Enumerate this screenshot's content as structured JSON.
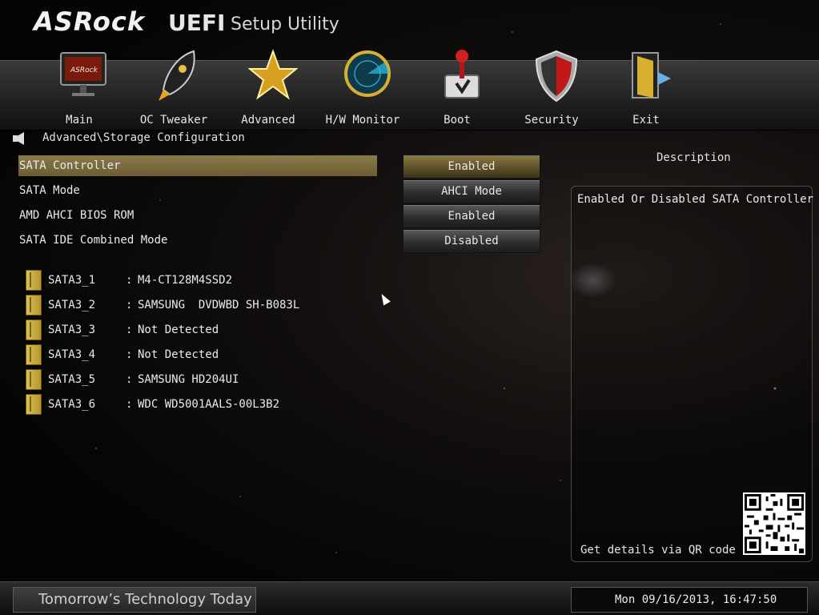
{
  "header": {
    "brand": "ASRock",
    "title_strong": "UEFI",
    "title_rest": "Setup Utility"
  },
  "nav": {
    "items": [
      {
        "label": "Main",
        "icon": "monitor-icon"
      },
      {
        "label": "OC Tweaker",
        "icon": "rocket-icon"
      },
      {
        "label": "Advanced",
        "icon": "star-icon"
      },
      {
        "label": "H/W Monitor",
        "icon": "radar-icon"
      },
      {
        "label": "Boot",
        "icon": "joystick-icon"
      },
      {
        "label": "Security",
        "icon": "shield-icon"
      },
      {
        "label": "Exit",
        "icon": "exit-door-icon"
      }
    ]
  },
  "breadcrumb": "Advanced\\Storage Configuration",
  "settings": [
    {
      "label": "SATA Controller",
      "value": "Enabled"
    },
    {
      "label": "SATA Mode",
      "value": "AHCI Mode"
    },
    {
      "label": "AMD AHCI BIOS ROM",
      "value": "Enabled"
    },
    {
      "label": "SATA IDE Combined Mode",
      "value": "Disabled"
    }
  ],
  "drives": [
    {
      "port": "SATA3_1",
      "sep": ":",
      "model": "M4-CT128M4SSD2"
    },
    {
      "port": "SATA3_2",
      "sep": ":",
      "model": "SAMSUNG  DVDWBD SH-B083L"
    },
    {
      "port": "SATA3_3",
      "sep": ":",
      "model": "Not Detected"
    },
    {
      "port": "SATA3_4",
      "sep": ":",
      "model": "Not Detected"
    },
    {
      "port": "SATA3_5",
      "sep": ":",
      "model": "SAMSUNG HD204UI"
    },
    {
      "port": "SATA3_6",
      "sep": ":",
      "model": "WDC WD5001AALS-00L3B2"
    }
  ],
  "description": {
    "title": "Description",
    "text": "Enabled Or Disabled SATA Controller",
    "qr_label": "Get details via QR code"
  },
  "footer": {
    "slogan": "Tomorrow’s Technology Today",
    "datetime": "Mon 09/16/2013, 16:47:50"
  },
  "colors": {
    "selected_row": "#8a7a4a",
    "drive_icon": "#d8c15a"
  }
}
